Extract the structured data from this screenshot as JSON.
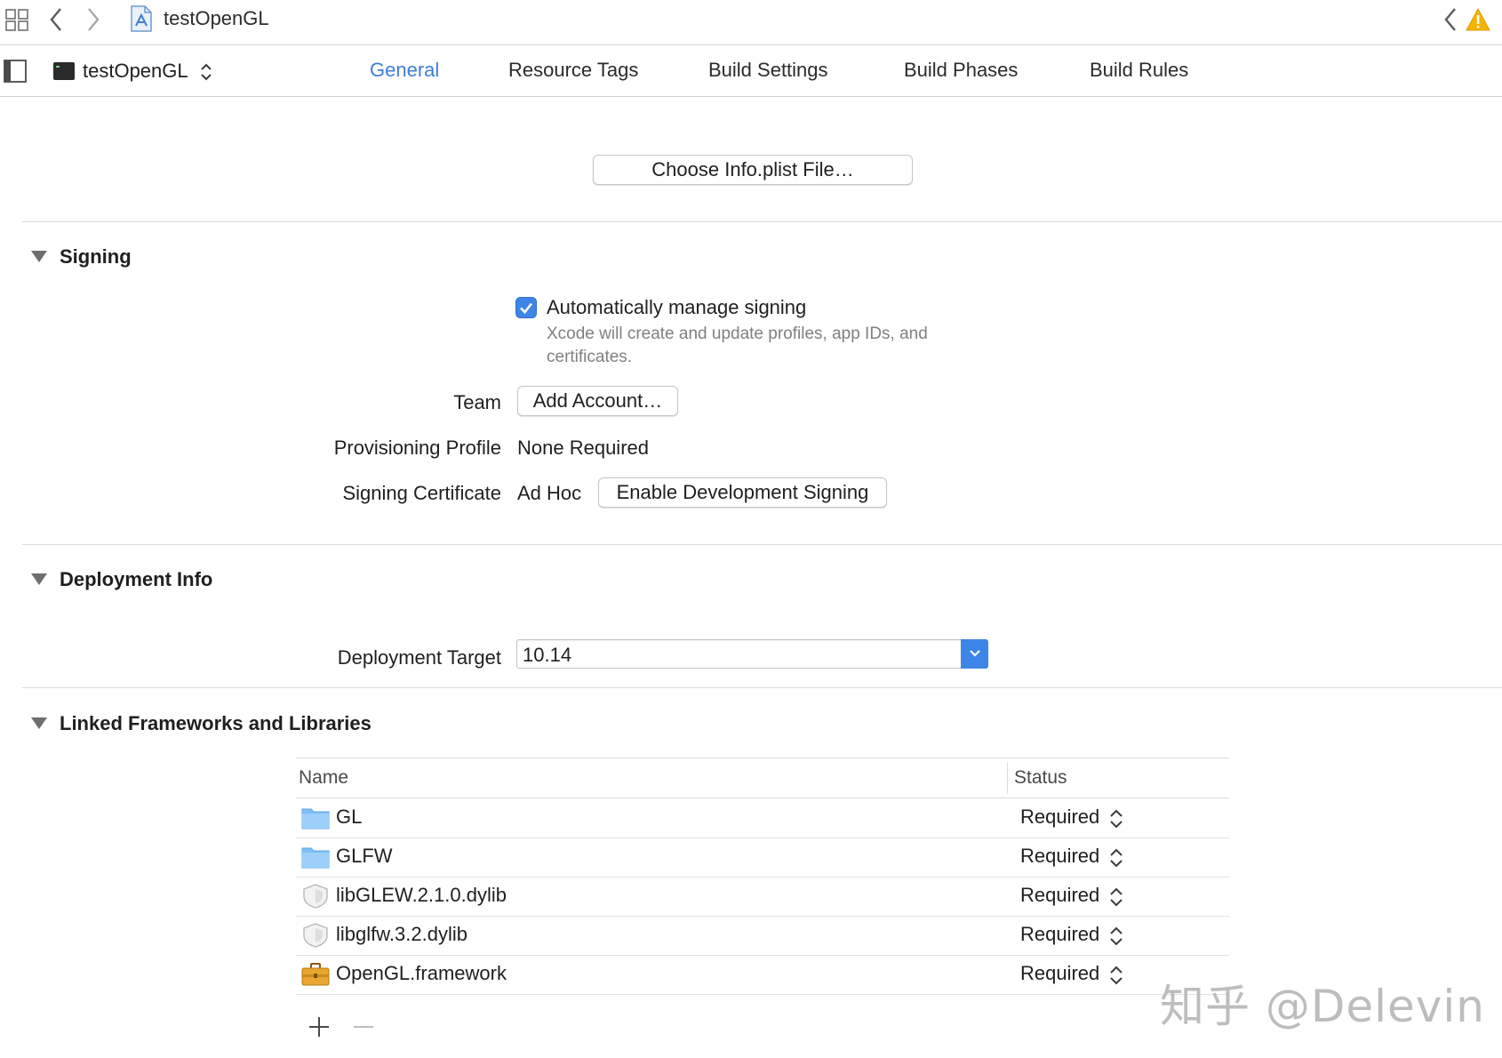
{
  "window": {
    "title": "testOpenGL"
  },
  "toolbar": {
    "grid_icon": "grid-icon",
    "back_icon": "chevron-left-icon",
    "forward_icon": "chevron-right-icon",
    "project_icon": "xcode-project-icon",
    "issue_back_icon": "chevron-left-icon",
    "warning_icon": "warning-icon",
    "warning_color": "#f5b400"
  },
  "target_bar": {
    "target_name": "testOpenGL",
    "tabs": [
      {
        "label": "General",
        "active": true
      },
      {
        "label": "Resource Tags",
        "active": false
      },
      {
        "label": "Build Settings",
        "active": false
      },
      {
        "label": "Build Phases",
        "active": false
      },
      {
        "label": "Build Rules",
        "active": false
      }
    ],
    "accent_color": "#3d7fd6"
  },
  "info_plist": {
    "button_label": "Choose Info.plist File…"
  },
  "signing": {
    "title": "Signing",
    "auto_manage_label": "Automatically manage signing",
    "auto_manage_checked": true,
    "auto_manage_hint": "Xcode will create and update profiles, app IDs, and certificates.",
    "team_label": "Team",
    "team_button": "Add Account…",
    "provisioning_label": "Provisioning Profile",
    "provisioning_value": "None Required",
    "certificate_label": "Signing Certificate",
    "certificate_value": "Ad Hoc",
    "enable_dev_button": "Enable Development Signing"
  },
  "deployment": {
    "title": "Deployment Info",
    "target_label": "Deployment Target",
    "target_value": "10.14"
  },
  "frameworks": {
    "title": "Linked Frameworks and Libraries",
    "columns": {
      "name": "Name",
      "status": "Status"
    },
    "rows": [
      {
        "name": "GL",
        "status": "Required",
        "icon": "folder-icon"
      },
      {
        "name": "GLFW",
        "status": "Required",
        "icon": "folder-icon"
      },
      {
        "name": "libGLEW.2.1.0.dylib",
        "status": "Required",
        "icon": "library-shield-icon"
      },
      {
        "name": "libglfw.3.2.dylib",
        "status": "Required",
        "icon": "library-shield-icon"
      },
      {
        "name": "OpenGL.framework",
        "status": "Required",
        "icon": "toolbox-icon"
      }
    ],
    "add_icon": "plus-icon",
    "remove_icon": "minus-icon"
  },
  "watermark": {
    "text": "知乎 @Delevin"
  }
}
